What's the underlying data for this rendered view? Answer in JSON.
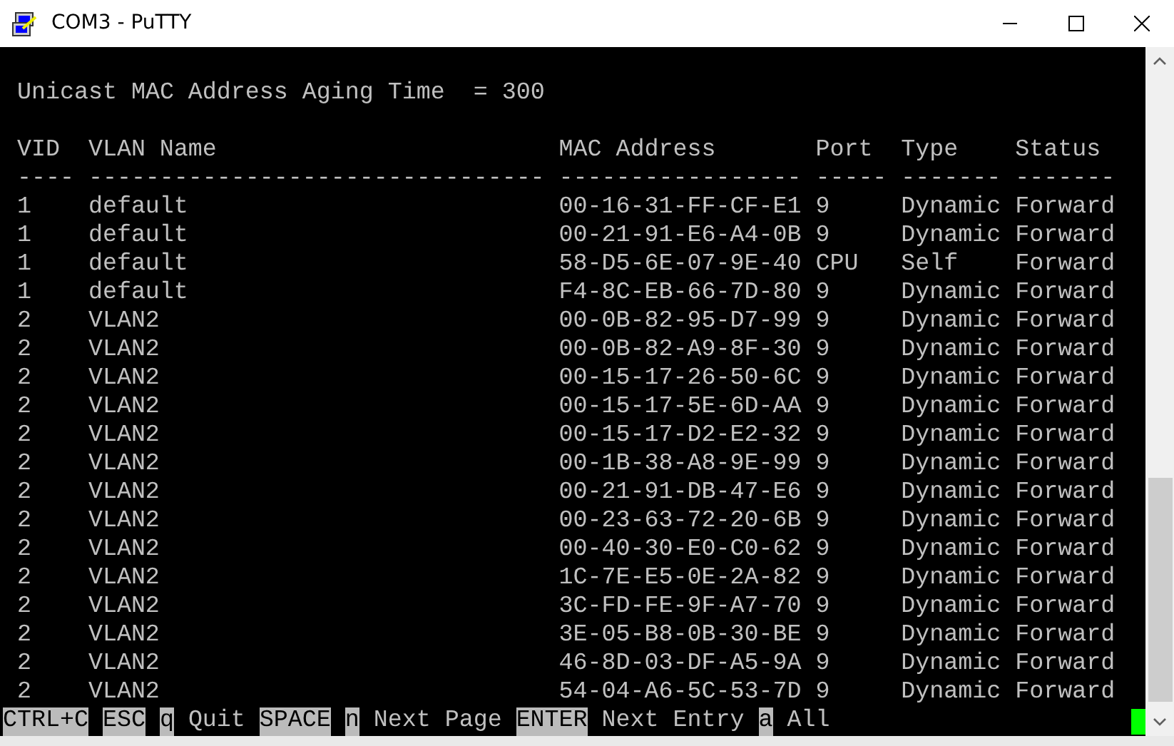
{
  "window": {
    "title": "COM3 - PuTTY"
  },
  "terminal": {
    "aging_line": "Unicast MAC Address Aging Time  = 300",
    "columns": [
      "VID",
      "VLAN Name",
      "MAC Address",
      "Port",
      "Type",
      "Status"
    ],
    "dashes": [
      "----",
      "--------------------------------",
      "-----------------",
      "-----",
      "-------",
      "-------"
    ],
    "rows": [
      [
        "1",
        "default",
        "00-16-31-FF-CF-E1",
        "9",
        "Dynamic",
        "Forward"
      ],
      [
        "1",
        "default",
        "00-21-91-E6-A4-0B",
        "9",
        "Dynamic",
        "Forward"
      ],
      [
        "1",
        "default",
        "58-D5-6E-07-9E-40",
        "CPU",
        "Self",
        "Forward"
      ],
      [
        "1",
        "default",
        "F4-8C-EB-66-7D-80",
        "9",
        "Dynamic",
        "Forward"
      ],
      [
        "2",
        "VLAN2",
        "00-0B-82-95-D7-99",
        "9",
        "Dynamic",
        "Forward"
      ],
      [
        "2",
        "VLAN2",
        "00-0B-82-A9-8F-30",
        "9",
        "Dynamic",
        "Forward"
      ],
      [
        "2",
        "VLAN2",
        "00-15-17-26-50-6C",
        "9",
        "Dynamic",
        "Forward"
      ],
      [
        "2",
        "VLAN2",
        "00-15-17-5E-6D-AA",
        "9",
        "Dynamic",
        "Forward"
      ],
      [
        "2",
        "VLAN2",
        "00-15-17-D2-E2-32",
        "9",
        "Dynamic",
        "Forward"
      ],
      [
        "2",
        "VLAN2",
        "00-1B-38-A8-9E-99",
        "9",
        "Dynamic",
        "Forward"
      ],
      [
        "2",
        "VLAN2",
        "00-21-91-DB-47-E6",
        "9",
        "Dynamic",
        "Forward"
      ],
      [
        "2",
        "VLAN2",
        "00-23-63-72-20-6B",
        "9",
        "Dynamic",
        "Forward"
      ],
      [
        "2",
        "VLAN2",
        "00-40-30-E0-C0-62",
        "9",
        "Dynamic",
        "Forward"
      ],
      [
        "2",
        "VLAN2",
        "1C-7E-E5-0E-2A-82",
        "9",
        "Dynamic",
        "Forward"
      ],
      [
        "2",
        "VLAN2",
        "3C-FD-FE-9F-A7-70",
        "9",
        "Dynamic",
        "Forward"
      ],
      [
        "2",
        "VLAN2",
        "3E-05-B8-0B-30-BE",
        "9",
        "Dynamic",
        "Forward"
      ],
      [
        "2",
        "VLAN2",
        "46-8D-03-DF-A5-9A",
        "9",
        "Dynamic",
        "Forward"
      ],
      [
        "2",
        "VLAN2",
        "54-04-A6-5C-53-7D",
        "9",
        "Dynamic",
        "Forward"
      ]
    ],
    "footer": [
      {
        "kind": "key",
        "text": "CTRL+C"
      },
      {
        "kind": "key",
        "text": "ESC"
      },
      {
        "kind": "key",
        "text": "q"
      },
      {
        "kind": "label",
        "text": "Quit"
      },
      {
        "kind": "key",
        "text": "SPACE"
      },
      {
        "kind": "key",
        "text": "n"
      },
      {
        "kind": "label",
        "text": "Next Page"
      },
      {
        "kind": "key",
        "text": "ENTER"
      },
      {
        "kind": "label",
        "text": "Next Entry"
      },
      {
        "kind": "key",
        "text": "a"
      },
      {
        "kind": "label",
        "text": "All"
      }
    ]
  }
}
